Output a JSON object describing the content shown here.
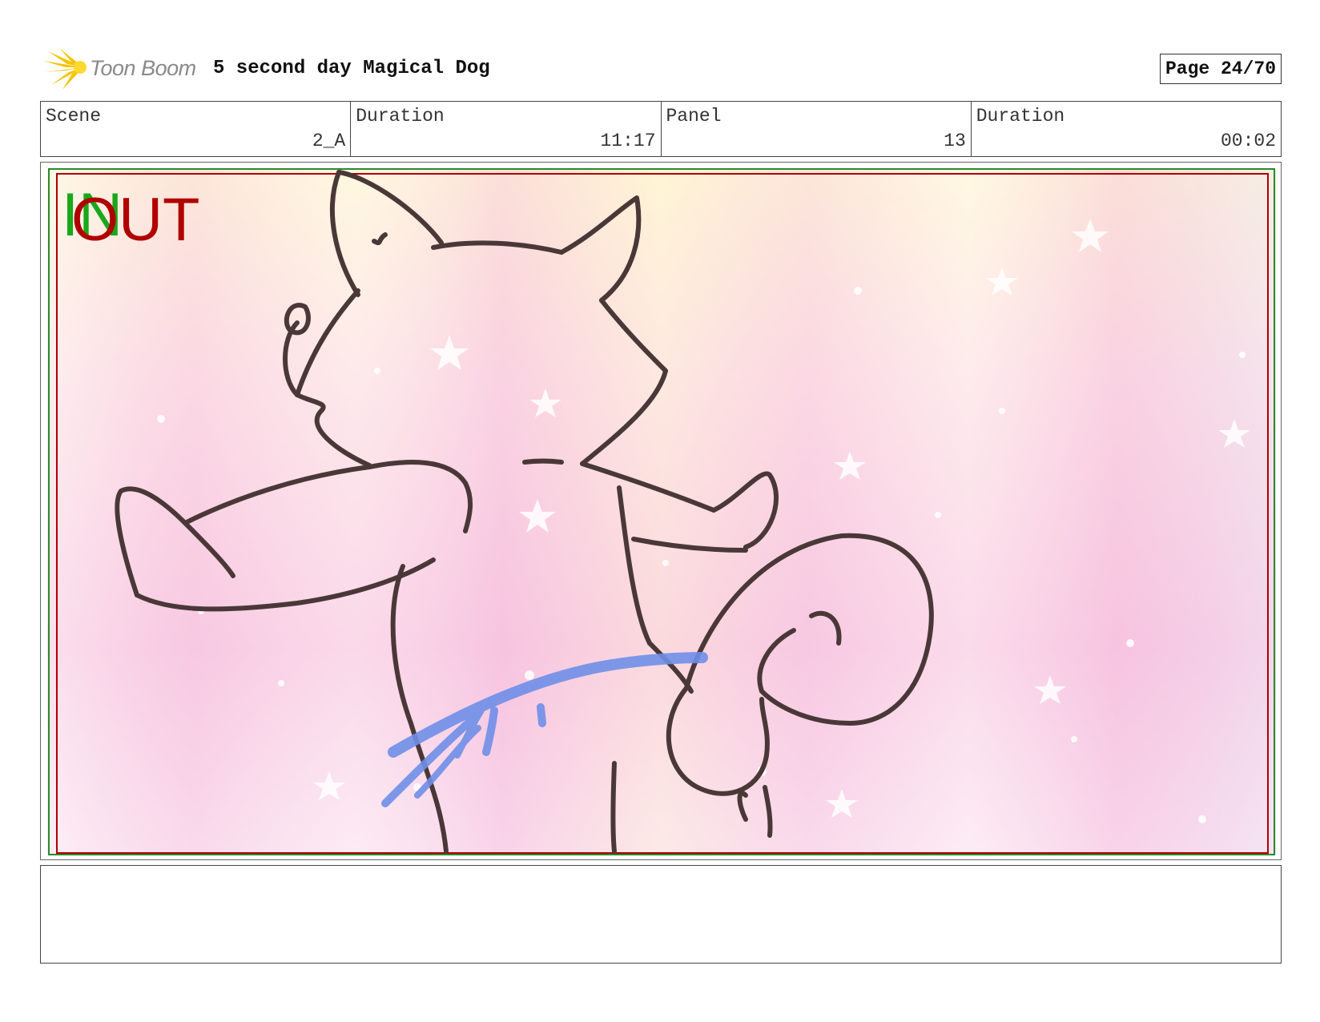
{
  "header": {
    "logo_text": "Toon Boom",
    "project_title": "5 second day Magical Dog",
    "page_label": "Page 24/70"
  },
  "info": {
    "scene_label": "Scene",
    "scene_value": "2_A",
    "scene_duration_label": "Duration",
    "scene_duration_value": "11:17",
    "panel_label": "Panel",
    "panel_value": "13",
    "panel_duration_label": "Duration",
    "panel_duration_value": "00:02"
  },
  "panel": {
    "in_marker": "IN",
    "out_marker": "OUT",
    "in_color": "#1aa81a",
    "out_color": "#b00000",
    "sketch_line_color": "#4a3838",
    "motion_stroke_color": "#6f8fe8"
  },
  "notes": {
    "text": ""
  }
}
